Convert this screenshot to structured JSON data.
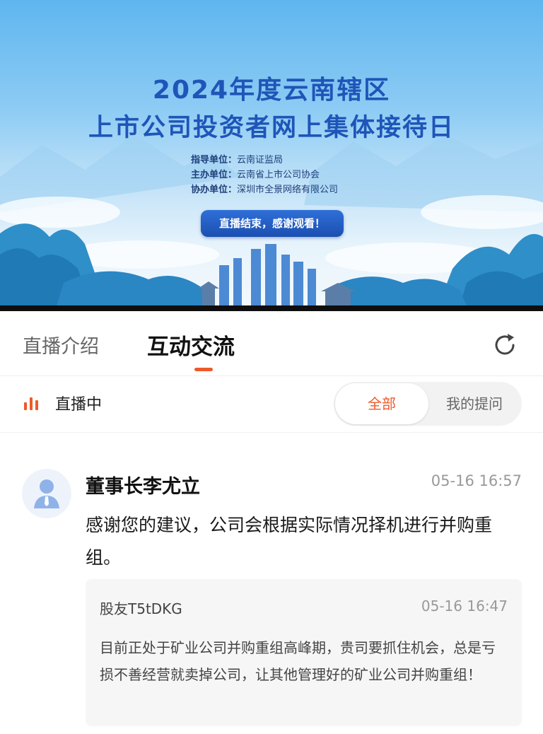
{
  "banner": {
    "title_line1": "2024年度云南辖区",
    "title_line2": "上市公司投资者网上集体接待日",
    "orgs": [
      {
        "key": "指导单位：",
        "value": "云南证监局"
      },
      {
        "key": "主办单位：",
        "value": "云南省上市公司协会"
      },
      {
        "key": "协办单位：",
        "value": "深圳市全景网络有限公司"
      }
    ],
    "status_button": "直播结束，感谢观看！"
  },
  "tabs": {
    "intro_label": "直播介绍",
    "qa_label": "互动交流",
    "active": "互动交流",
    "accent_color": "#ec5a2a",
    "refresh_icon": "refresh-icon"
  },
  "filter": {
    "live_label": "直播中",
    "live_icon": "signal-bars-icon",
    "segments": {
      "all": "全部",
      "mine": "我的提问"
    },
    "selected": "全部"
  },
  "message": {
    "answerer": "董事长李尤立",
    "answer_time": "05-16 16:57",
    "answer_text": "感谢您的建议，公司会根据实际情况择机进行并购重组。",
    "question": {
      "asker": "股友T5tDKG",
      "time": "05-16 16:47",
      "text": "目前正处于矿业公司并购重组高峰期，贵司要抓住机会，总是亏损不善经营就卖掉公司，让其他管理好的矿业公司并购重组！"
    }
  }
}
